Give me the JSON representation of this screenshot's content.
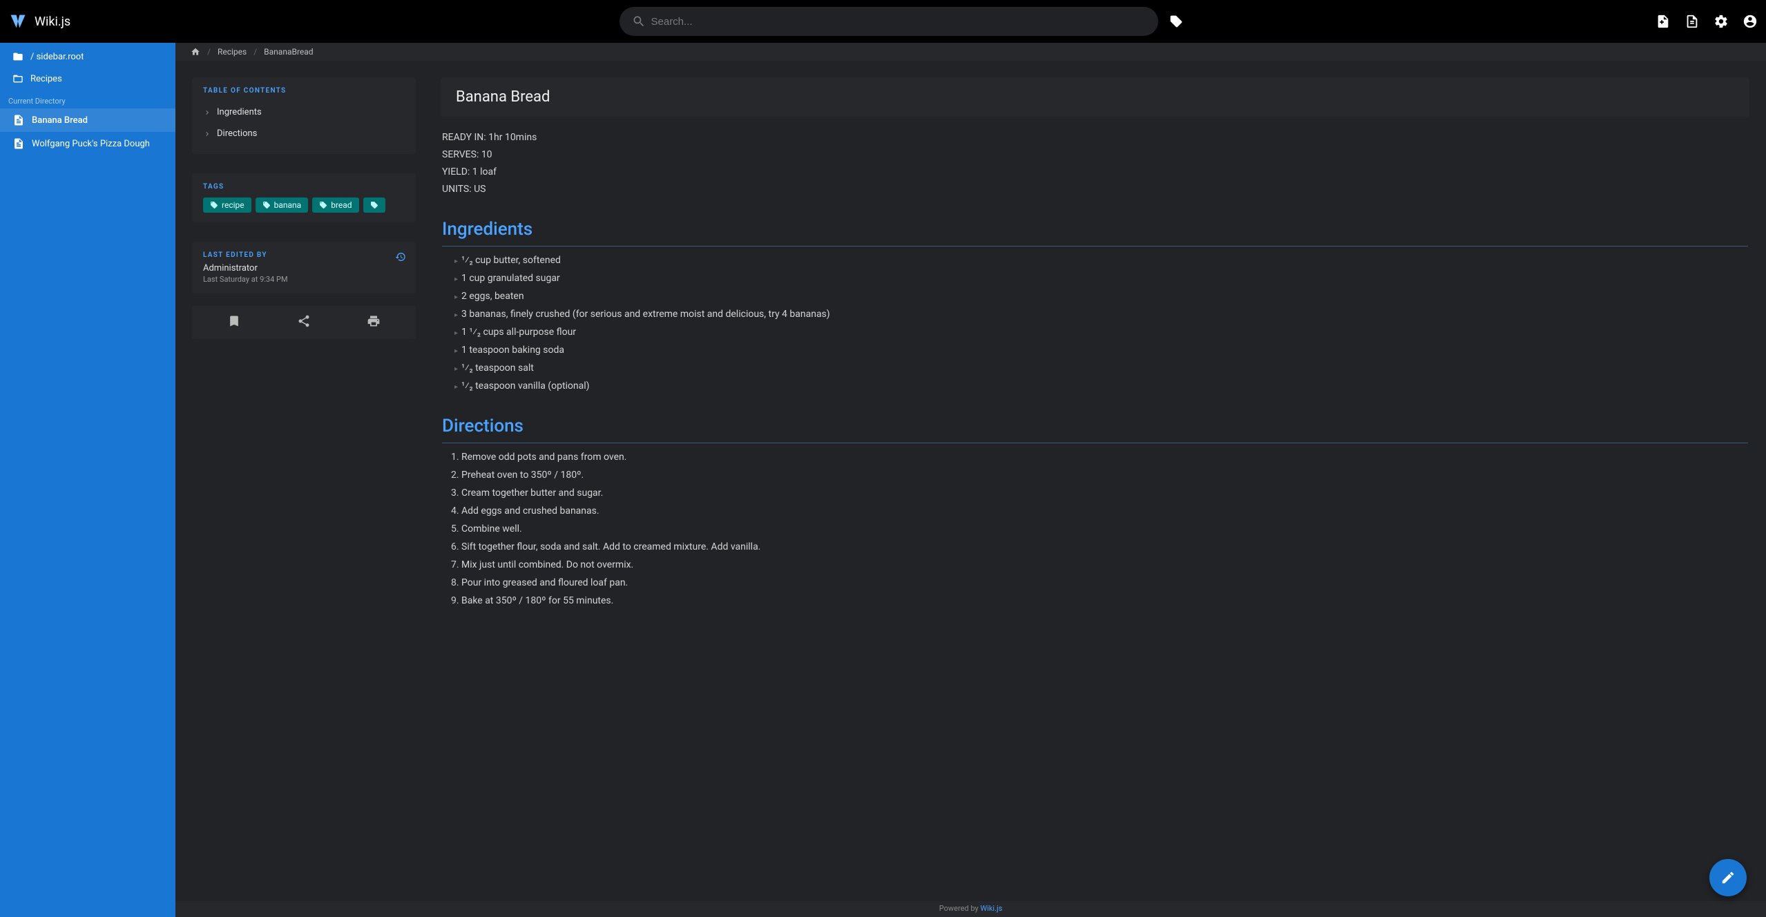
{
  "site": {
    "title": "Wiki.js"
  },
  "search": {
    "placeholder": "Search..."
  },
  "sidebar": {
    "root": "/ sidebar.root",
    "recipes": "Recipes",
    "subhead": "Current Directory",
    "pages": [
      {
        "label": "Banana Bread",
        "active": true
      },
      {
        "label": "Wolfgang Puck's Pizza Dough",
        "active": false
      }
    ]
  },
  "breadcrumb": {
    "items": [
      "Recipes",
      "BananaBread"
    ]
  },
  "toc": {
    "header": "TABLE OF CONTENTS",
    "items": [
      "Ingredients",
      "Directions"
    ]
  },
  "tags": {
    "header": "TAGS",
    "items": [
      "recipe",
      "banana",
      "bread"
    ]
  },
  "lastedit": {
    "header": "LAST EDITED BY",
    "user": "Administrator",
    "time": "Last Saturday at 9:34 PM"
  },
  "article": {
    "title": "Banana Bread",
    "meta": [
      "READY IN: 1hr 10mins",
      "SERVES: 10",
      "YIELD: 1 loaf",
      "UNITS: US"
    ],
    "sections": {
      "ingredients_h": "Ingredients",
      "ingredients": [
        "¹⁄₂ cup butter, softened",
        "1 cup granulated sugar",
        "2 eggs, beaten",
        "3 bananas, finely crushed (for serious and extreme moist and delicious, try 4 bananas)",
        "1 ¹⁄₂ cups all-purpose flour",
        "1 teaspoon baking soda",
        "¹⁄₂ teaspoon salt",
        "¹⁄₂ teaspoon vanilla (optional)"
      ],
      "directions_h": "Directions",
      "directions": [
        "Remove odd pots and pans from oven.",
        "Preheat oven to 350º / 180º.",
        "Cream together butter and sugar.",
        "Add eggs and crushed bananas.",
        "Combine well.",
        "Sift together flour, soda and salt. Add to creamed mixture. Add vanilla.",
        "Mix just until combined. Do not overmix.",
        "Pour into greased and floured loaf pan.",
        "Bake at 350º / 180º for 55 minutes."
      ]
    }
  },
  "footer": {
    "powered": "Powered by ",
    "link": "Wiki.js"
  }
}
